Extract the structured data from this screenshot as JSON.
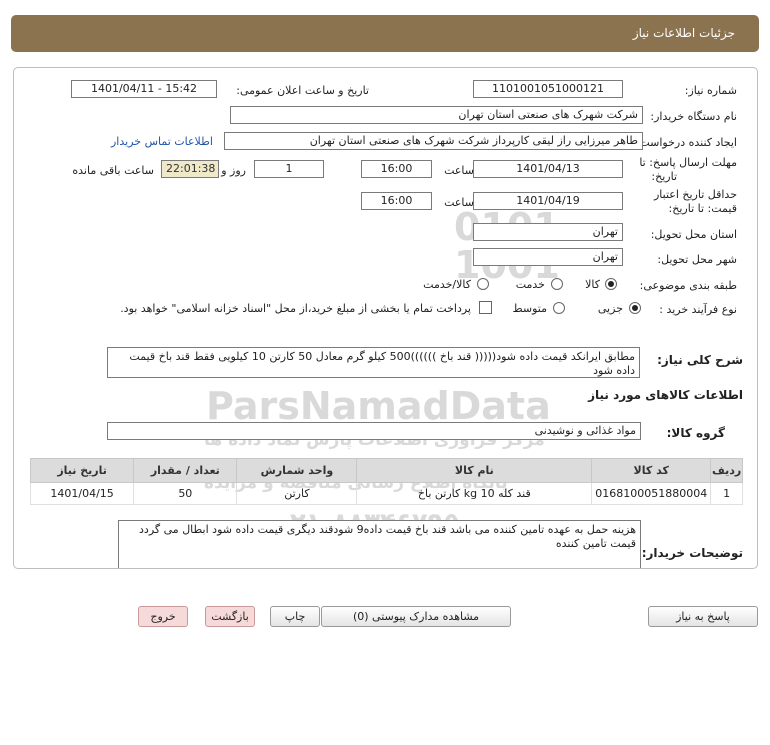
{
  "header": {
    "title": "جزئیات اطلاعات نیاز"
  },
  "form": {
    "need_number_label": "شماره نیاز:",
    "need_number": "1101001051000121",
    "announce_label": "تاریخ و ساعت اعلان عمومی:",
    "announce_value": "1401/04/11 - 15:42",
    "buyer_org_label": "نام دستگاه خریدار:",
    "buyer_org": "شرکت شهرک های صنعتی استان تهران",
    "creator_label": "ایجاد کننده درخواست:",
    "creator": "طاهر  میرزایی راز لیقی کارپرداز شرکت شهرک های صنعتی استان تهران",
    "contact_link": "اطلاعات تماس خریدار",
    "deadline_label_1": "مهلت ارسال پاسخ: تا",
    "deadline_label_2": "تاریخ:",
    "deadline_date": "1401/04/13",
    "time_label": "ساعت",
    "deadline_time": "16:00",
    "days_value": "1",
    "days_label": "روز و",
    "remaining_time": "22:01:38",
    "remaining_label": "ساعت باقی مانده",
    "validity_label_1": "حداقل تاریخ اعتبار",
    "validity_label_2": "قیمت: تا تاریخ:",
    "validity_date": "1401/04/19",
    "validity_time": "16:00",
    "province_label": "استان محل تحویل:",
    "province": "تهران",
    "city_label": "شهر محل تحویل:",
    "city": "تهران",
    "category_label": "طبقه بندی موضوعی:",
    "category_options": [
      "کالا",
      "خدمت",
      "کالا/خدمت"
    ],
    "category_selected": "کالا",
    "process_label": "نوع فرآیند خرید :",
    "process_options": [
      "جزیی",
      "متوسط"
    ],
    "process_selected": "جزیی",
    "treasury_note": "پرداخت تمام یا بخشی از مبلغ خرید،از محل \"اسناد خزانه اسلامی\" خواهد بود.",
    "description_label": "شرح کلی نیاز:",
    "description": "مطابق ایرانکد قیمت داده شود((((( قند باخ ))))))500 کیلو گرم معادل 50 کارتن 10 کیلویی فقط قند باخ قیمت داده شود",
    "goods_info_title": "اطلاعات کالاهای مورد نیاز",
    "goods_group_label": "گروه کالا:",
    "goods_group": "مواد غذائی و نوشیدنی",
    "buyer_notes_label": "توضیحات خریدار:",
    "buyer_notes": "هزینه حمل به عهده تامین کننده می باشد قند باخ قیمت داده9 شودقند دیگری قیمت داده شود ابطال می گردد قیمت تامین کننده"
  },
  "table": {
    "headers": [
      "ردیف",
      "کد کالا",
      "نام کالا",
      "واحد شمارش",
      "تعداد / مقدار",
      "تاریخ نیاز"
    ],
    "rows": [
      [
        "1",
        "0168100051880004",
        "قند کله 10 kg کارتن باخ",
        "کارتن",
        "50",
        "1401/04/15"
      ]
    ]
  },
  "watermark": {
    "digits": "0101\n1001",
    "brand": "ParsNamadData",
    "line1": "مرکز فراوری اطلاعات پارس نماد داده ها",
    "line2": "پایگاه اطلاع رسانی مناقصه و مزایده",
    "phone": "۰۲۱-۸۸۳۴۶۷۹۵"
  },
  "buttons": {
    "reply": "پاسخ به نیاز",
    "attachments": "مشاهده مدارک پیوستی (0)",
    "print": "چاپ",
    "back": "بازگشت",
    "exit": "خروج"
  }
}
